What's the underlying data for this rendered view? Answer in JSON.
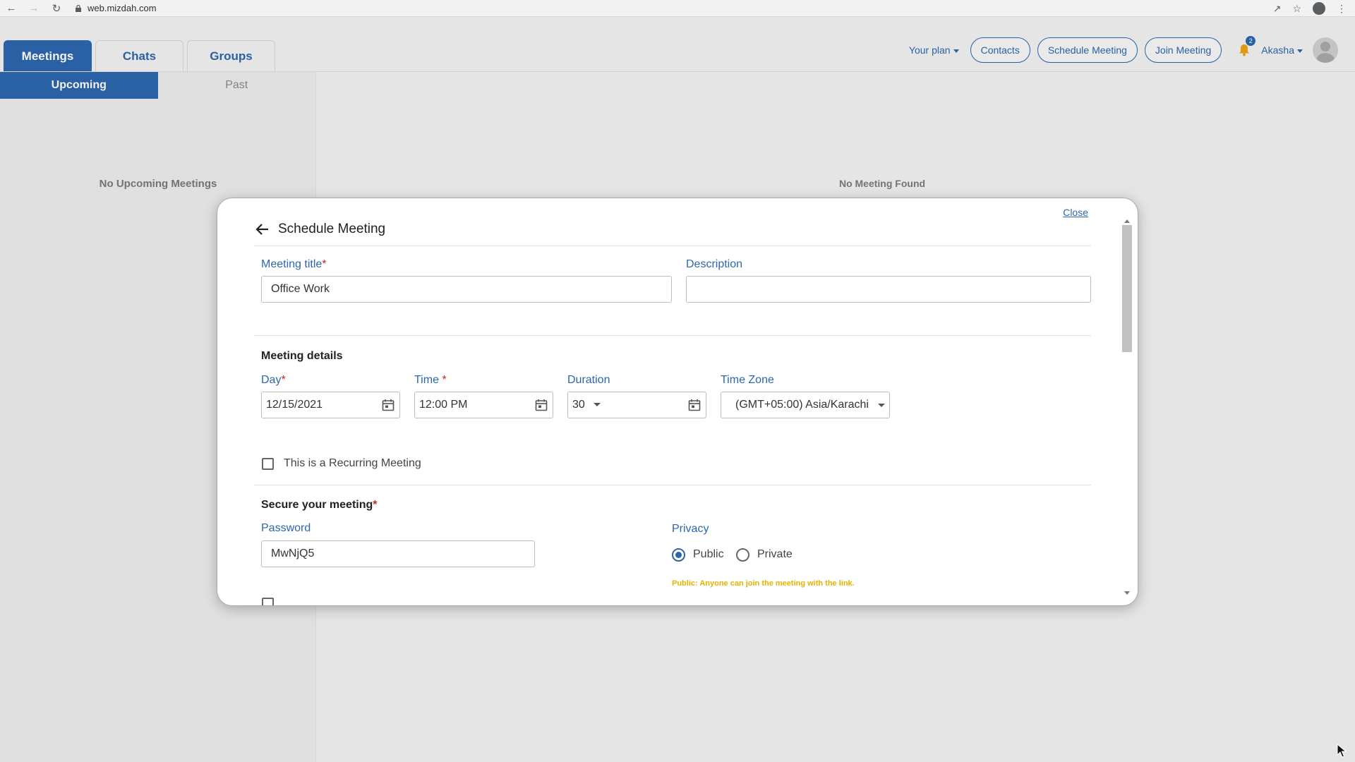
{
  "browser": {
    "url": "web.mizdah.com"
  },
  "header": {
    "tabs": [
      {
        "label": "Meetings",
        "active": true
      },
      {
        "label": "Chats",
        "active": false
      },
      {
        "label": "Groups",
        "active": false
      }
    ],
    "plan_label": "Your plan",
    "contacts_label": "Contacts",
    "schedule_label": "Schedule Meeting",
    "join_label": "Join Meeting",
    "notification_count": "2",
    "user_name": "Akasha",
    "accent_color": "#2c67ad"
  },
  "left_panel": {
    "subtabs": [
      {
        "label": "Upcoming",
        "active": true
      },
      {
        "label": "Past",
        "active": false
      }
    ],
    "empty_text": "No Upcoming Meetings"
  },
  "main": {
    "empty_text": "No Meeting Found"
  },
  "modal": {
    "title": "Schedule Meeting",
    "close_label": "Close",
    "meeting_title": {
      "label": "Meeting title",
      "value": "Office Work"
    },
    "description": {
      "label": "Description",
      "value": ""
    },
    "details_heading": "Meeting details",
    "day": {
      "label": "Day",
      "value": "12/15/2021"
    },
    "time": {
      "label": "Time ",
      "value": "12:00 PM"
    },
    "duration": {
      "label": "Duration",
      "value": "30"
    },
    "timezone": {
      "label": "Time Zone",
      "value": "(GMT+05:00) Asia/Karachi"
    },
    "recurring": {
      "label": "This is a Recurring Meeting",
      "checked": false
    },
    "secure_heading": "Secure your meeting",
    "password": {
      "label": "Password",
      "value": "MwNjQ5"
    },
    "privacy": {
      "label": "Privacy",
      "options": [
        {
          "label": "Public",
          "checked": true
        },
        {
          "label": "Private",
          "checked": false
        }
      ],
      "note": "Public: Anyone can join the meeting with the link."
    }
  }
}
